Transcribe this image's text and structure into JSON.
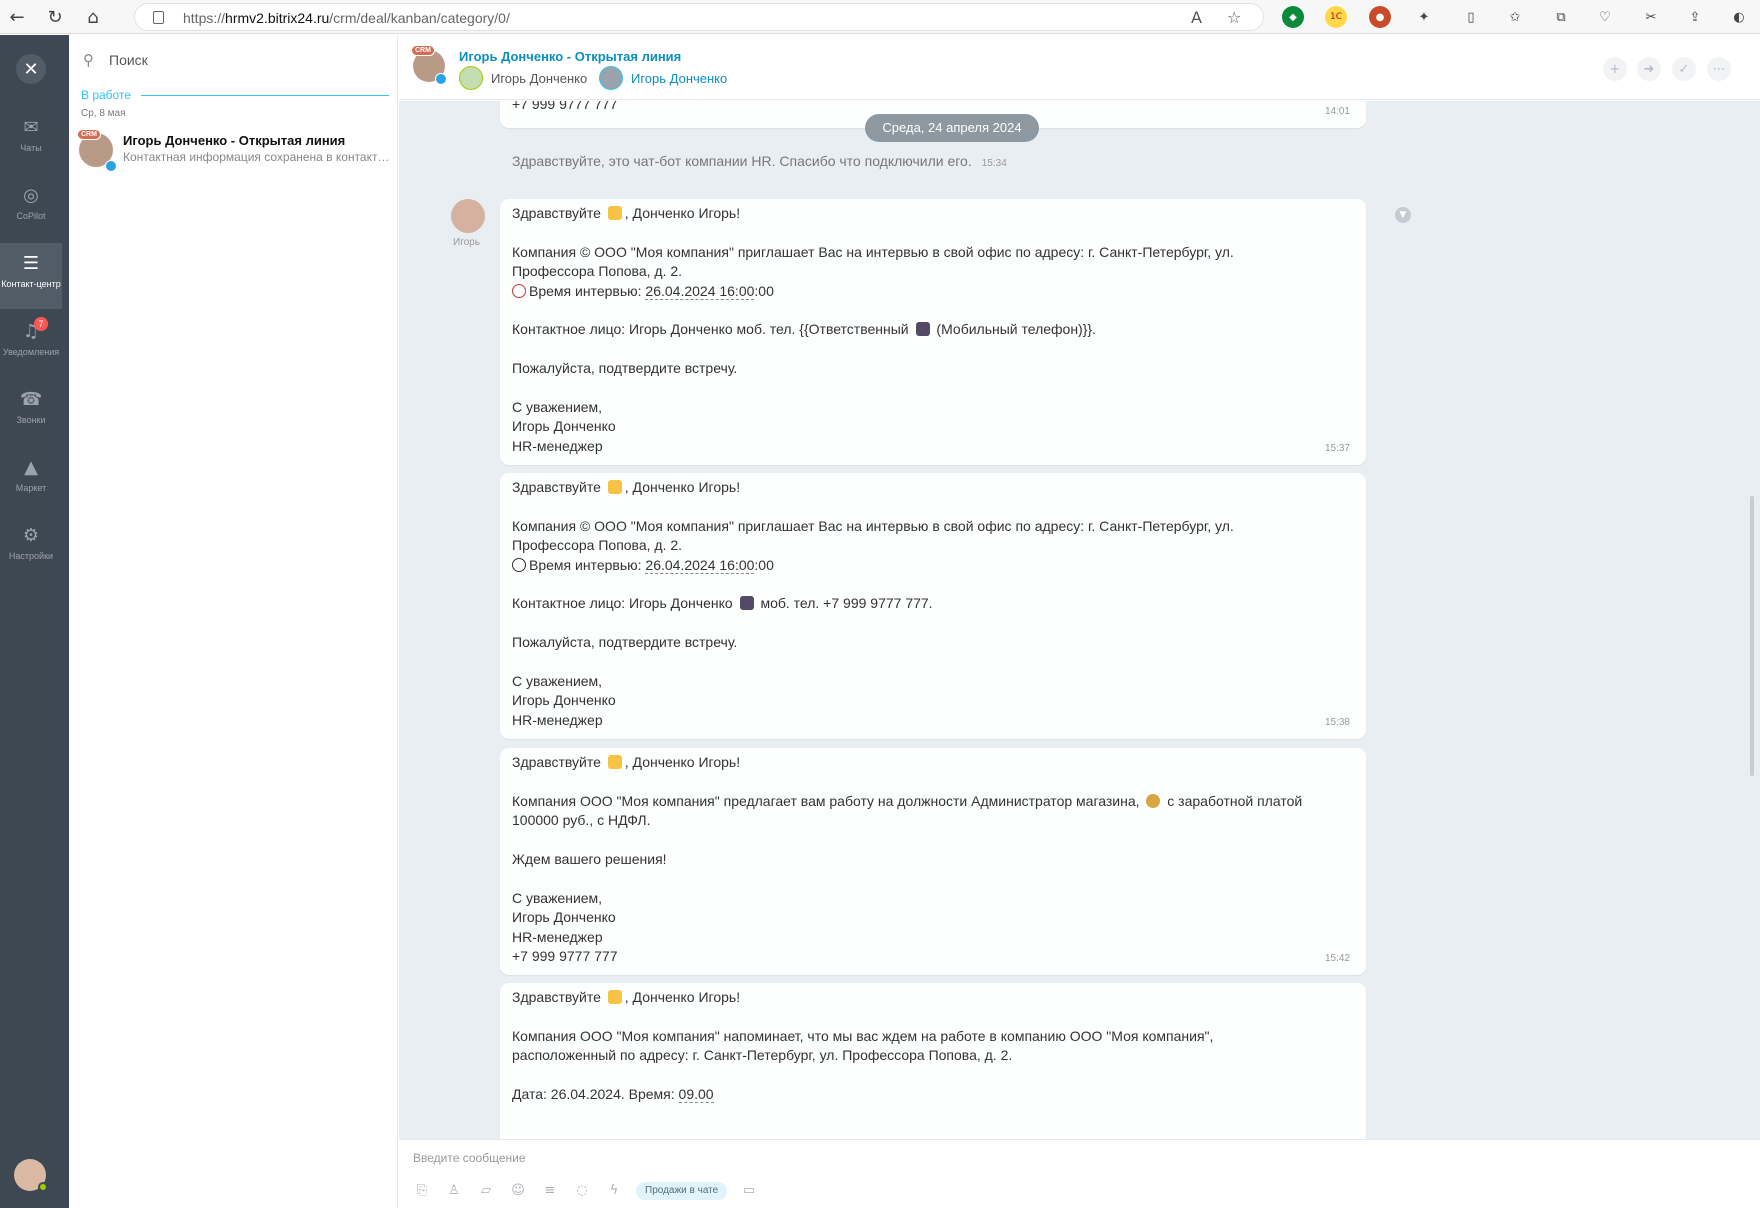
{
  "browser": {
    "url_prefix": "https://",
    "url_domain": "hrmv2.bitrix24.ru",
    "url_path": "/crm/deal/kanban/category/0/"
  },
  "rail": {
    "items": [
      {
        "label": "Чаты",
        "icon": "chat-icon"
      },
      {
        "label": "CoPilot",
        "icon": "copilot-icon"
      },
      {
        "label": "Контакт-центр",
        "icon": "contact-center-icon"
      },
      {
        "label": "Уведомления",
        "icon": "bell-icon",
        "badge": "7"
      },
      {
        "label": "Звонки",
        "icon": "phone-icon"
      },
      {
        "label": "Маркет",
        "icon": "market-icon"
      },
      {
        "label": "Настройки",
        "icon": "gear-icon"
      }
    ]
  },
  "sidebar": {
    "search_placeholder": "Поиск",
    "section_title": "В работе",
    "section_date": "Ср, 8 мая",
    "recent": {
      "crm_tag": "CRM",
      "title": "Игорь Донченко - Открытая линия",
      "preview": "Контактная информация сохранена в контакте CRM"
    }
  },
  "header": {
    "crm_tag": "CRM",
    "title": "Игорь Донченко - Открытая линия",
    "participant_1": "Игорь Донченко",
    "participant_2": "Игорь Донченко"
  },
  "feed": {
    "prev_bubble_phone": "+7 999 9777 777",
    "prev_bubble_time": "14:01",
    "date_separator": "Среда, 24 апреля 2024",
    "system_message": "Здравствуйте, это чат-бот компании HR. Спасибо что подключили его.",
    "system_time": "15:34",
    "author_name": "Игорь",
    "msg1": {
      "greet_a": "Здравствуйте ",
      "greet_b": ", Донченко Игорь!",
      "company_line1": "Компания © ООО \"Моя компания\" приглашает Вас на интервью в свой офис по адресу: г. Санкт-Петербург, ул.",
      "company_line2": "Профессора Попова, д. 2.",
      "time_label": "Время интервью: ",
      "time_value": "26.04.2024 16:00",
      "time_suffix": ":00",
      "contact_a": "Контактное лицо: Игорь Донченко моб. тел. {{Ответственный ",
      "contact_b": " (Мобильный телефон)}}.",
      "confirm": "Пожалуйста, подтвердите встречу.",
      "regards": "С уважением,",
      "sign_name": "Игорь Донченко",
      "sign_role": "HR-менеджер",
      "time": "15:37"
    },
    "msg2": {
      "greet_a": "Здравствуйте ",
      "greet_b": ", Донченко Игорь!",
      "company_line1": "Компания © ООО \"Моя компания\" приглашает Вас на интервью в свой офис по адресу: г. Санкт-Петербург, ул.",
      "company_line2": "Профессора Попова, д. 2.",
      "time_label": "Время интервью: ",
      "time_value": "26.04.2024 16:00",
      "time_suffix": ":00",
      "contact_a": "Контактное лицо: Игорь Донченко ",
      "contact_b": " моб. тел. +7 999 9777 777.",
      "confirm": "Пожалуйста, подтвердите встречу.",
      "regards": "С уважением,",
      "sign_name": "Игорь Донченко",
      "sign_role": "HR-менеджер",
      "time": "15:38"
    },
    "msg3": {
      "greet_a": "Здравствуйте ",
      "greet_b": ", Донченко Игорь!",
      "offer_a": "Компания ООО \"Моя компания\" предлагает вам работу на должности Администратор магазина, ",
      "offer_b": " с заработной платой",
      "offer_line2": "100000 руб., с НДФЛ.",
      "wait": "Ждем вашего решения!",
      "regards": "С уважением,",
      "sign_name": "Игорь Донченко",
      "sign_role": "HR-менеджер",
      "sign_phone": "+7 999 9777 777",
      "time": "15:42"
    },
    "msg4": {
      "greet_a": "Здравствуйте ",
      "greet_b": ", Донченко Игорь!",
      "remind_line1": "Компания ООО \"Моя компания\" напоминает, что мы вас ждем на работе в компанию ООО \"Моя компания\",",
      "remind_line2": "расположенный по адресу: г. Санкт-Петербург, ул. Профессора Попова, д. 2.",
      "date_label": "Дата: 26.04.2024. Время: ",
      "date_time": "09.00"
    }
  },
  "composer": {
    "placeholder": "Введите сообщение",
    "sales_label": "Продажи в чате"
  },
  "colors": {
    "rail_bg": "#3e4853",
    "accent": "#2fc6f6",
    "title_blue": "#0a8fbe",
    "feed_bg": "#e9eef2",
    "badge_red": "#ff5752"
  }
}
